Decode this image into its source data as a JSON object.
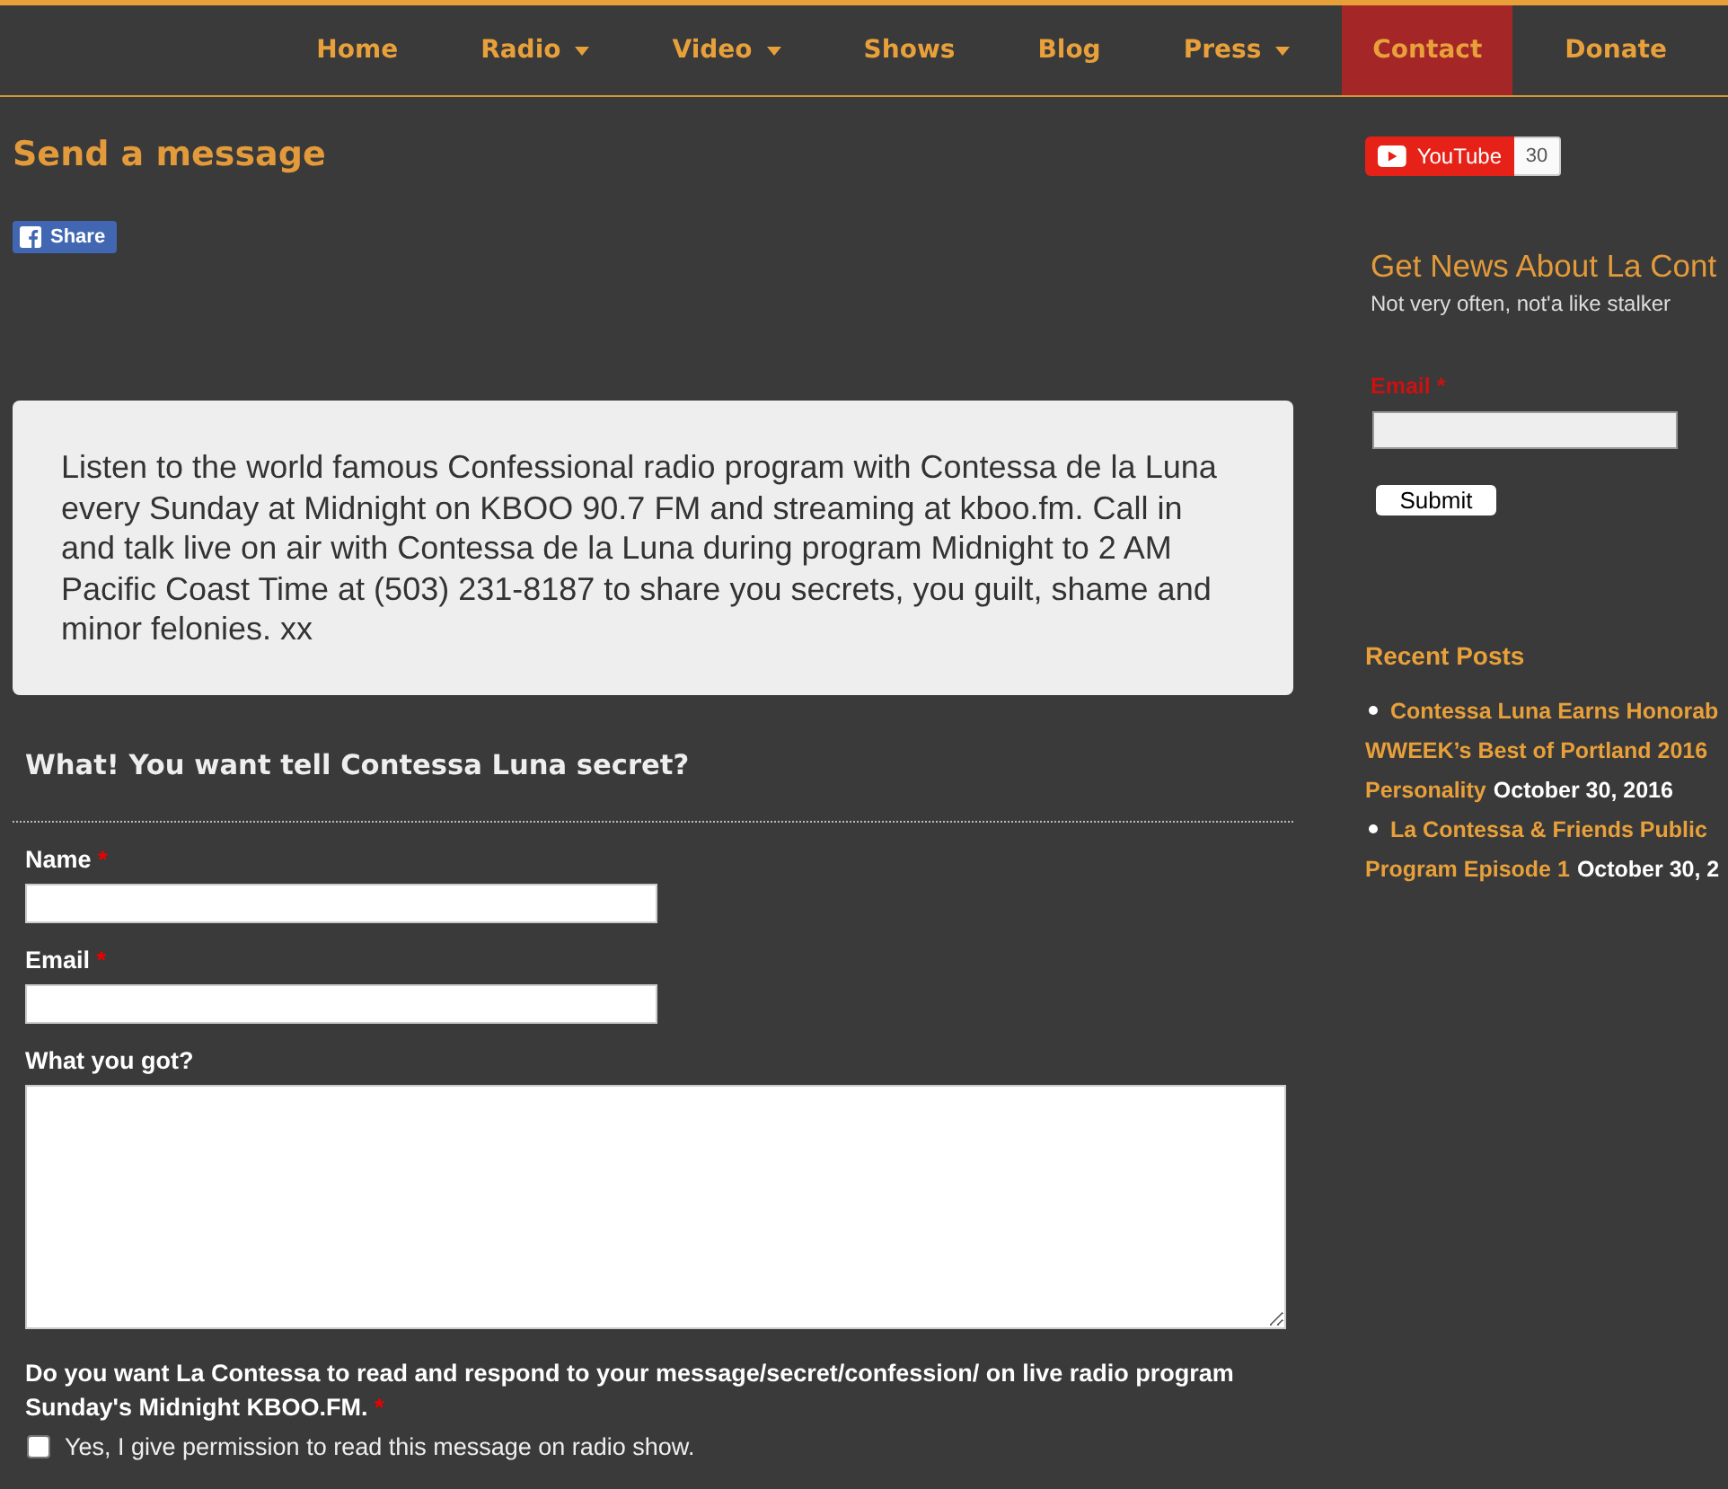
{
  "nav": {
    "items": [
      {
        "label": "Home",
        "has_menu": false,
        "selected": false
      },
      {
        "label": "Radio",
        "has_menu": true,
        "selected": false
      },
      {
        "label": "Video",
        "has_menu": true,
        "selected": false
      },
      {
        "label": "Shows",
        "has_menu": false,
        "selected": false
      },
      {
        "label": "Blog",
        "has_menu": false,
        "selected": false
      },
      {
        "label": "Press",
        "has_menu": true,
        "selected": false
      },
      {
        "label": "Contact",
        "has_menu": false,
        "selected": true
      },
      {
        "label": "Donate",
        "has_menu": false,
        "selected": false
      }
    ]
  },
  "main": {
    "title": "Send a message",
    "share_button": {
      "label": "Share"
    },
    "intro": "Listen to the world famous Confessional radio program with Contessa de la Luna every Sunday at Midnight on KBOO 90.7 FM and streaming at kboo.fm. Call in and talk live on air with Contessa de la Luna during program Midnight to 2 AM Pacific Coast Time at (503) 231-8187 to share you secrets, you guilt, shame and minor felonies. xx"
  },
  "form": {
    "title": "What! You want tell Contessa Luna secret?",
    "required_mark": "*",
    "fields": [
      {
        "kind": "text",
        "label": "Name",
        "required": true
      },
      {
        "kind": "text",
        "label": "Email",
        "required": true
      },
      {
        "kind": "textarea",
        "label": "What you got?",
        "required": false
      }
    ],
    "question": {
      "label": "Do you want La Contessa to read and respond to your message/secret/confession/ on live radio program Sunday's Midnight KBOO.FM.",
      "required": true
    },
    "options": [
      {
        "label": "Yes, I give permission to read this message on radio show.",
        "checked": false
      }
    ]
  },
  "sidebar": {
    "youtube": {
      "label": "YouTube",
      "count": "30"
    },
    "newsletter": {
      "title": "Get News About La Cont",
      "subtitle": "Not very often, not'a like stalker",
      "email_label": "Email",
      "required": true,
      "required_mark": "*",
      "submit": "Submit"
    },
    "recent_posts": {
      "title": "Recent Posts",
      "posts": [
        {
          "title_lines": [
            "Contessa Luna Earns Honorab",
            "WWEEK’s Best of Portland 2016",
            "Personality"
          ],
          "date": "October 30, 2016"
        },
        {
          "title_lines": [
            "La Contessa & Friends Public",
            "Program Episode 1"
          ],
          "date": "October 30, 2"
        }
      ]
    }
  }
}
